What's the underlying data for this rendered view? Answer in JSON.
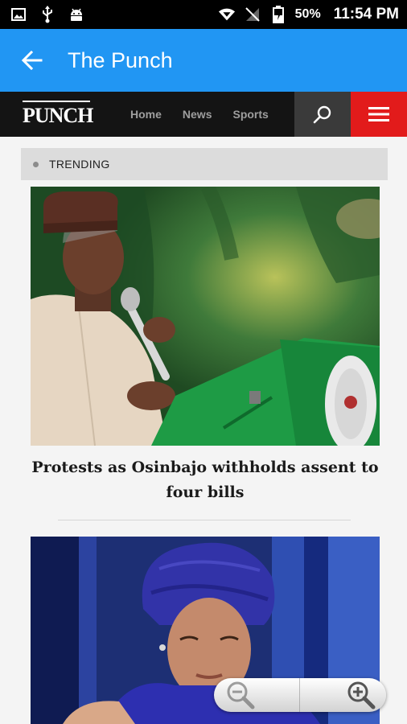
{
  "status_bar": {
    "battery_percent": "50%",
    "time": "11:54 PM",
    "icons": [
      "image-icon",
      "usb-icon",
      "android-icon",
      "wifi-icon",
      "no-signal-icon",
      "battery-icon"
    ]
  },
  "app_bar": {
    "title": "The Punch",
    "color": "#2196f3"
  },
  "site_nav": {
    "logo_text": "PUNCH",
    "links": [
      "Home",
      "News",
      "Sports"
    ],
    "menu_color": "#e21b1b"
  },
  "trending": {
    "label": "TRENDING"
  },
  "articles": [
    {
      "title": "Protests as Osinbajo withholds assent to four bills",
      "image": "man-speaking-at-podium-photo"
    },
    {
      "title": "",
      "image": "woman-in-blue-headwrap-photo"
    }
  ],
  "zoom_controls": {
    "icons": [
      "zoom-out-icon",
      "zoom-in-icon"
    ]
  }
}
